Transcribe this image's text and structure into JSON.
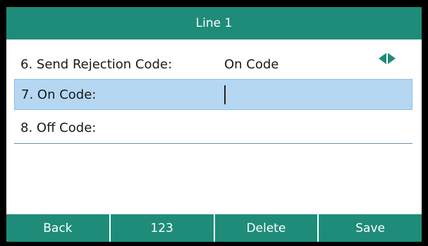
{
  "title": "Line 1",
  "rows": [
    {
      "label": "6. Send Rejection Code:",
      "value": "On Code"
    },
    {
      "label": "7. On Code:",
      "value": ""
    },
    {
      "label": "8. Off Code:",
      "value": ""
    }
  ],
  "softkeys": [
    "Back",
    "123",
    "Delete",
    "Save"
  ],
  "colors": {
    "accent": "#1e8c79",
    "selection": "#b5d7f2",
    "bezel": "#000000"
  },
  "icons": {
    "left_arrow": "arrow-left-icon",
    "right_arrow": "arrow-right-icon"
  }
}
